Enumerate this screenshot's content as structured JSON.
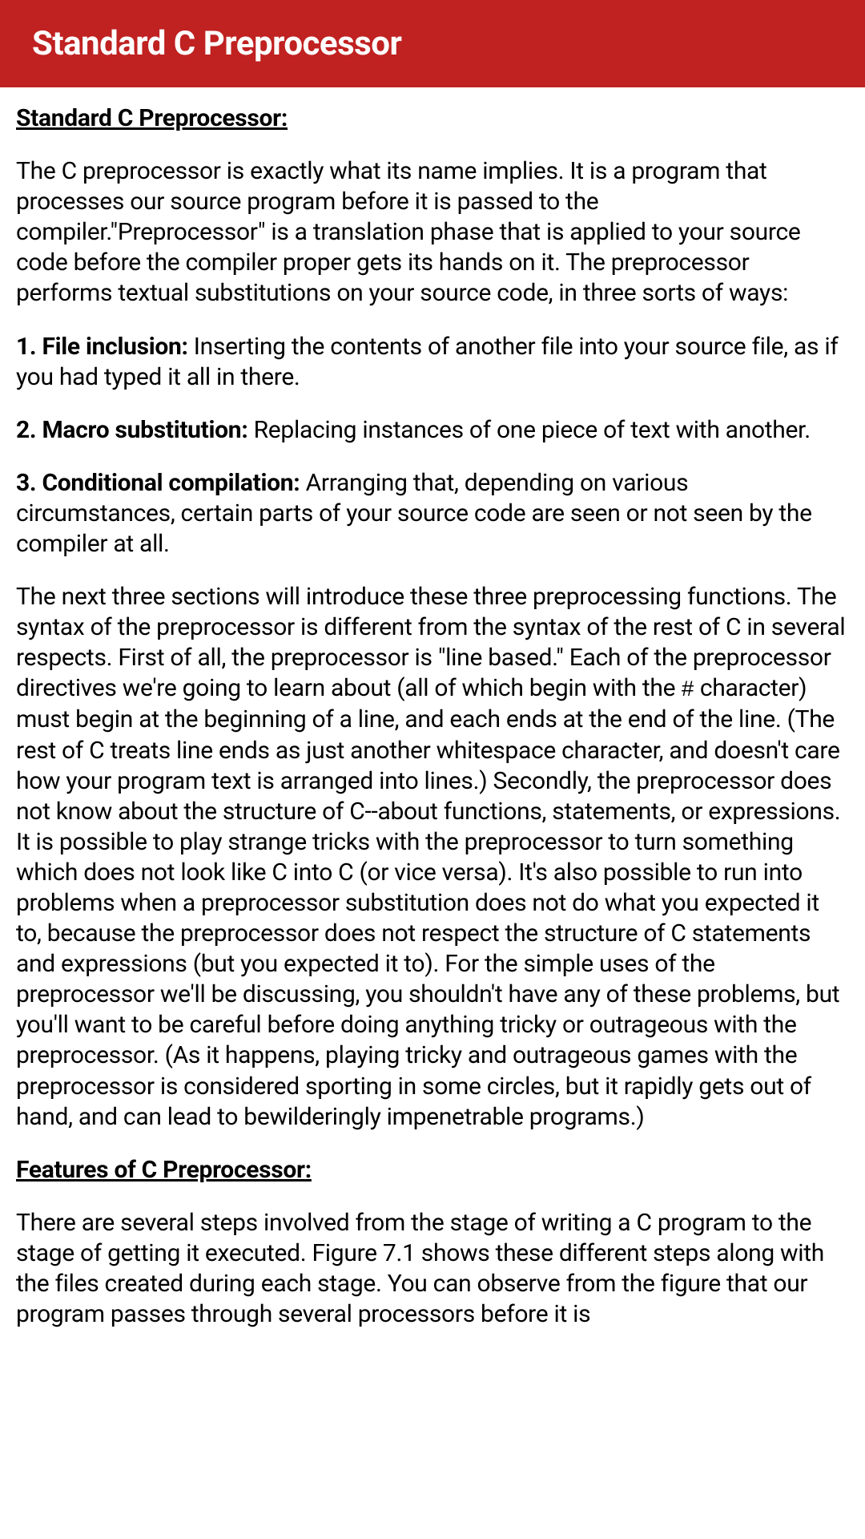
{
  "header": {
    "title": "Standard C Preprocessor"
  },
  "content": {
    "heading1": "Standard C Preprocessor:",
    "intro": "The C preprocessor is exactly what its name implies. It is a program that processes our source program before it is passed to the compiler.\"Preprocessor\" is a translation phase that is applied to your source code before the compiler proper gets its hands on it.  The preprocessor performs textual substitutions on your source code, in three sorts of ways:",
    "item1_label": "1. File inclusion:",
    "item1_text": " Inserting the contents of another file into your source file, as if you had typed it all in there.",
    "item2_label": "2. Macro substitution:",
    "item2_text": " Replacing instances of one piece of text with another.",
    "item3_label": "3. Conditional compilation:",
    "item3_text": " Arranging that, depending on various circumstances, certain parts of your source code are seen or not seen by the compiler at all.",
    "para2a": "The next three sections will introduce these three preprocessing functions. The syntax of the preprocessor is different from the syntax of the rest of C in several respects. First of all, the preprocessor is \"line based.\" Each of the preprocessor directives we're going to learn about (all of which begin with the ",
    "hash": "#",
    "para2b": " character) must begin at the beginning of a line, and each ends at the end of the line. (The rest of C treats line ends as just another whitespace character, and doesn't care how your program text is arranged into lines.) Secondly, the preprocessor does not know about the structure of C--about functions, statements, or expressions. It is possible to play strange tricks with the preprocessor to turn something which does not look like C into C (or vice versa). It's also possible to run into problems when a preprocessor substitution does not do what you expected it to, because the preprocessor does not respect the structure of C statements and expressions (but you expected it to). For the simple uses of the preprocessor we'll be discussing, you shouldn't have any of these problems, but you'll want to be careful before doing anything tricky or outrageous with the preprocessor. (As it happens, playing tricky and outrageous games with the preprocessor is considered sporting in some circles, but it rapidly gets out of hand, and can lead to bewilderingly impenetrable programs.)",
    "heading2": "Features of C Preprocessor:",
    "para3": "There are several steps involved from the stage of writing a C program to the stage of getting it executed. Figure 7.1 shows these different steps along with the files created during each stage. You can observe from the figure that our program passes through several processors before it is"
  }
}
